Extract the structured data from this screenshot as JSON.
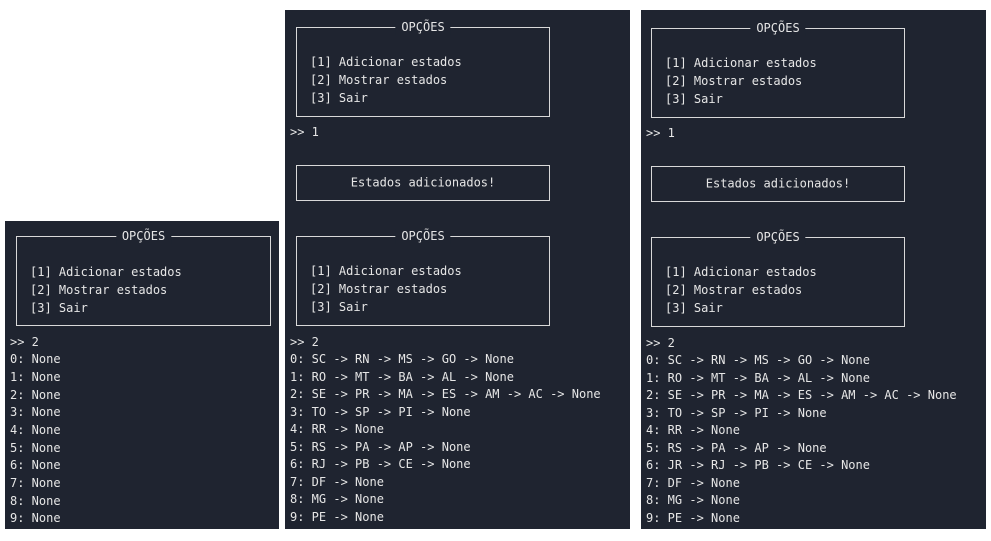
{
  "menu": {
    "title": "OPÇÕES",
    "items": [
      "[1] Adicionar estados",
      "[2] Mostrar estados",
      "[3] Sair"
    ]
  },
  "prompt1": ">> 1",
  "prompt2": ">> 2",
  "message": "Estados adicionados!",
  "panel1": {
    "rows": [
      "0: None",
      "1: None",
      "2: None",
      "3: None",
      "4: None",
      "5: None",
      "6: None",
      "7: None",
      "8: None",
      "9: None"
    ]
  },
  "panel2": {
    "rows": [
      "0: SC -> RN -> MS -> GO -> None",
      "1: RO -> MT -> BA -> AL -> None",
      "2: SE -> PR -> MA -> ES -> AM -> AC -> None",
      "3: TO -> SP -> PI -> None",
      "4: RR -> None",
      "5: RS -> PA -> AP -> None",
      "6: RJ -> PB -> CE -> None",
      "7: DF -> None",
      "8: MG -> None",
      "9: PE -> None"
    ]
  },
  "panel3": {
    "rows": [
      "0: SC -> RN -> MS -> GO -> None",
      "1: RO -> MT -> BA -> AL -> None",
      "2: SE -> PR -> MA -> ES -> AM -> AC -> None",
      "3: TO -> SP -> PI -> None",
      "4: RR -> None",
      "5: RS -> PA -> AP -> None",
      "6: JR -> RJ -> PB -> CE -> None",
      "7: DF -> None",
      "8: MG -> None",
      "9: PE -> None"
    ]
  }
}
